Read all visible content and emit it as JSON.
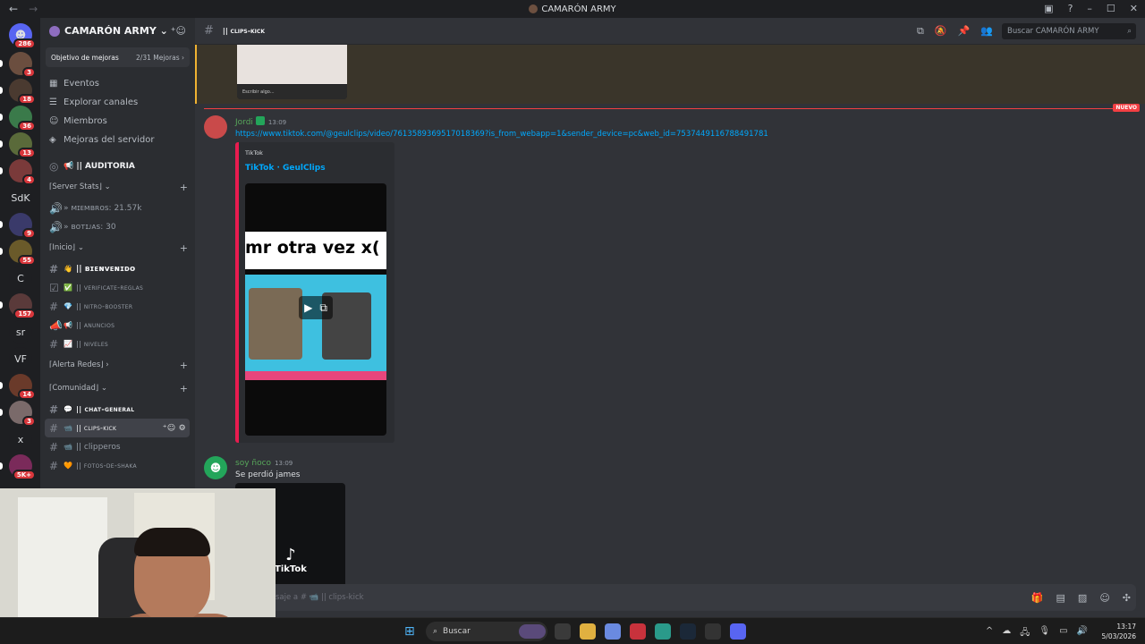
{
  "window": {
    "title": "CAMARÓN ARMY",
    "back_glyph": "←",
    "forward_glyph": "→",
    "controls": [
      "–",
      "☐",
      "✕"
    ],
    "extra_icons": [
      "inbox-icon",
      "help-icon"
    ]
  },
  "servers": [
    {
      "badge": "286",
      "label": "",
      "color": "#5865f2"
    },
    {
      "badge": "3",
      "label": "",
      "color": "#6b4e3f"
    },
    {
      "badge": "18",
      "label": "",
      "color": "#4a3a30"
    },
    {
      "badge": "36",
      "label": "",
      "color": "#3a7a4a"
    },
    {
      "badge": "13",
      "label": "",
      "color": "#5a6a3a"
    },
    {
      "badge": "4",
      "label": "",
      "color": "#7a3a3a"
    },
    {
      "badge": "",
      "label": "SdK",
      "color": ""
    },
    {
      "badge": "9",
      "label": "",
      "color": "#3a3a6a"
    },
    {
      "badge": "55",
      "label": "",
      "color": "#6a5a2a"
    },
    {
      "badge": "",
      "label": "C",
      "color": ""
    },
    {
      "badge": "157",
      "label": "",
      "color": "#5a3a3a"
    },
    {
      "badge": "",
      "label": "sr",
      "color": ""
    },
    {
      "badge": "",
      "label": "VF",
      "color": ""
    },
    {
      "badge": "14",
      "label": "",
      "color": "#6a3a2a"
    },
    {
      "badge": "3",
      "label": "",
      "color": "#7a6a6a"
    },
    {
      "badge": "",
      "label": "x",
      "color": ""
    },
    {
      "badge": "5K+",
      "label": "",
      "color": "#7a2a5a"
    }
  ],
  "sidebar": {
    "guild_name": "CAMARÓN ARMY ⌄",
    "boost_goal": "Objetivo de mejoras",
    "boost_count": "2/31 Mejoras ›",
    "nav": [
      {
        "icon": "calendar-icon",
        "glyph": "▦",
        "label": "Eventos"
      },
      {
        "icon": "compass-icon",
        "glyph": "☰",
        "label": "Explorar canales"
      },
      {
        "icon": "members-icon",
        "glyph": "☺",
        "label": "Miembros"
      },
      {
        "icon": "boost-icon",
        "glyph": "◈",
        "label": "Mejoras del servidor"
      }
    ],
    "auditoria": "📢 || AUDITORIA",
    "categories": {
      "server_stats": "⌈Server Stats⌋ ⌄",
      "inicio": "⌈Inicio⌋ ⌄",
      "alerta_redes": "⌈Alerta Redes⌋ ›",
      "comunidad": "⌈Comunidad⌋ ⌄"
    },
    "stats": [
      {
        "label": "» ᴍɪᴇᴍʙʀᴏs: 21.57k"
      },
      {
        "label": "» ʙᴏᴛɪᴊᴀs: 30"
      }
    ],
    "inicio_channels": [
      {
        "emoji": "👋",
        "label": "|| ʙɪᴇɴᴠᴇɴɪᴅᴏ",
        "bold": true
      },
      {
        "emoji": "✅",
        "label": "|| verificate-reglas",
        "bold": false
      },
      {
        "emoji": "💎",
        "label": "|| nitro-booster",
        "bold": false
      },
      {
        "emoji": "📢",
        "label": "|| anuncios",
        "bold": false
      },
      {
        "emoji": "📈",
        "label": "|| niveles",
        "bold": false
      }
    ],
    "comunidad_channels": [
      {
        "emoji": "💬",
        "label": "|| chat-general",
        "bold": true,
        "active": false
      },
      {
        "emoji": "📹",
        "label": "|| clips-kick",
        "bold": true,
        "active": true
      },
      {
        "emoji": "📹",
        "label": "|| clipperos",
        "bold": false,
        "active": false
      },
      {
        "emoji": "🧡",
        "label": "|| fotos-de-shaka",
        "bold": false,
        "active": false
      }
    ]
  },
  "channel": {
    "name": "|| clips-kick",
    "search_placeholder": "Buscar CAMARÓN ARMY"
  },
  "prev_embed": {
    "bar_text": "Escribir algo..."
  },
  "new_marker": "NUEVO",
  "messages": [
    {
      "author": "Jordi",
      "time": "13:09",
      "link": "https://www.tiktok.com/@geulclips/video/7613589369517018369?is_from_webapp=1&sender_device=pc&web_id=7537449116788491781",
      "embed": {
        "provider": "TikTok",
        "title": "TikTok · GeulClips",
        "caption": "mr otra vez x("
      }
    },
    {
      "author": "soy ñoco",
      "time": "13:09",
      "text": "Se perdió james",
      "card_label": "TikTok"
    }
  ],
  "composer": {
    "placeholder": "saje a # 📹 || clips-kick"
  },
  "taskbar": {
    "search": "Buscar",
    "time": "13:17",
    "date": "5/03/2026"
  }
}
